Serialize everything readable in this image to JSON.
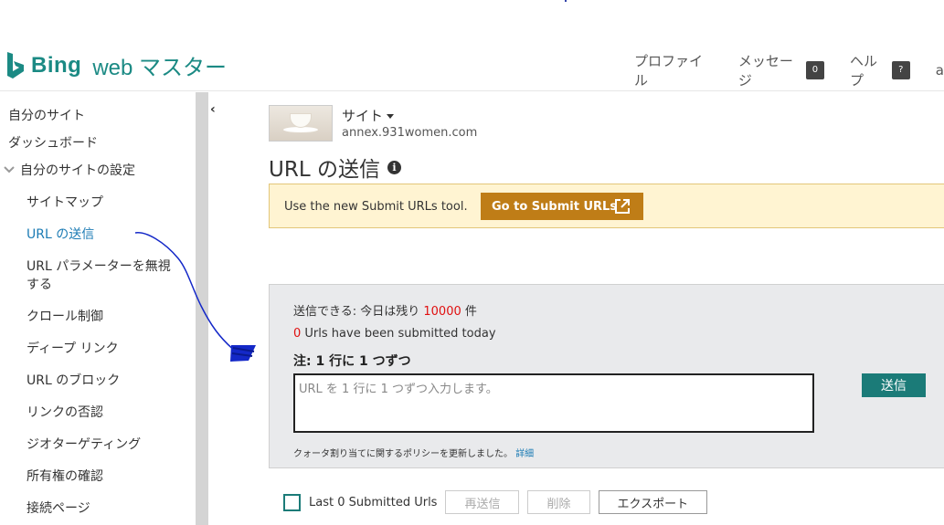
{
  "header": {
    "brand": "Bing",
    "brand_sub": "web マスター",
    "nav": [
      {
        "label": "プロファイル",
        "badge": ""
      },
      {
        "label": "メッセージ",
        "badge": "0"
      },
      {
        "label": "ヘルプ",
        "badge": "?"
      }
    ],
    "nav_trunc": "a"
  },
  "sidebar": {
    "items": [
      {
        "label": "自分のサイト"
      },
      {
        "label": "ダッシュボード"
      },
      {
        "label": "自分のサイトの設定"
      },
      {
        "label": "サイトマップ"
      },
      {
        "label": "URL の送信"
      },
      {
        "label": "URL パラメーターを無視"
      },
      {
        "label": "する"
      },
      {
        "label": "クロール制御"
      },
      {
        "label": "ディープ リンク"
      },
      {
        "label": "URL のブロック"
      },
      {
        "label": "リンクの否認"
      },
      {
        "label": "ジオターゲティング"
      },
      {
        "label": "所有権の確認"
      },
      {
        "label": "接続ページ"
      }
    ],
    "collapse_glyph": "‹"
  },
  "site": {
    "label": "サイト",
    "url": "annex.931women.com"
  },
  "page": {
    "title": "URL の送信",
    "info_glyph": "i"
  },
  "banner": {
    "text": "Use the new Submit URLs tool.",
    "button_label": "Go to Submit URLs"
  },
  "submit_panel": {
    "quota_prefix": "送信できる: 今日は残り ",
    "quota_value": "10000",
    "quota_suffix": " 件",
    "submitted_count": "0",
    "submitted_suffix": " Urls have been submitted today",
    "note": "注: 1 行に 1 つずつ",
    "textarea_placeholder": "URL を 1 行に 1 つずつ入力します。",
    "submit_label": "送信",
    "policy_text": "クォータ割り当てに関するポリシーを更新しました。",
    "policy_link": "詳細"
  },
  "bottom": {
    "checkbox_label": "Last 0 Submitted Urls",
    "resend_label": "再送信",
    "delete_label": "削除",
    "export_label": "エクスポート"
  },
  "colors": {
    "accent": "#1b8a84",
    "banner_button": "#bf7d17",
    "highlight": "#f7f220",
    "annotation": "#1428c8",
    "alert_red": "#e01010"
  }
}
